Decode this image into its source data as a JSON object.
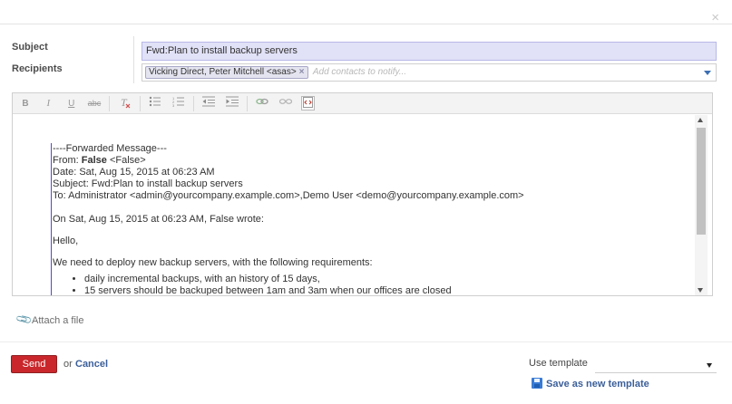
{
  "dialog": {
    "close_label": "×"
  },
  "form": {
    "subject_label": "Subject",
    "recipients_label": "Recipients",
    "subject_value": "Fwd:Plan to install backup servers",
    "recipient_tags": [
      "Vicking Direct, Peter Mitchell <asas>"
    ],
    "recipient_tag_remove": "×",
    "recipients_placeholder": "Add contacts to notify..."
  },
  "toolbar": {
    "buttons": [
      "B",
      "I",
      "U",
      "abc",
      "T",
      "list-bullets",
      "list-numbered",
      "outdent",
      "indent",
      "link",
      "unlink",
      "code"
    ],
    "active_button": "code-view"
  },
  "message": {
    "header": "----Forwarded Message---",
    "from_label": "From: ",
    "from_name": "False",
    "from_addr": " <False>",
    "date_line": "Date: Sat, Aug 15, 2015 at 06:23 AM",
    "subject_line": "Subject: Fwd:Plan to install backup servers",
    "to_line": "To: Administrator <admin@yourcompany.example.com>,Demo User <demo@yourcompany.example.com>",
    "wrote_line": "On Sat, Aug 15, 2015 at 06:23 AM, False wrote:",
    "greeting": "Hello,",
    "intro": "We need to deploy new backup servers, with the following requirements:",
    "requirements": [
      "daily incremental backups, with an history of 15 days,",
      "15 servers should be backuped between 1am and 3am when our offices are closed"
    ]
  },
  "attachments": {
    "attach_label": "Attach a file"
  },
  "footer": {
    "send_label": "Send",
    "or_label": "or",
    "cancel_label": "Cancel",
    "use_template_label": "Use template",
    "template_value": "",
    "save_template_label": "Save as new template"
  },
  "colors": {
    "send_button": "#c9272b",
    "link": "#3b5f9a",
    "subject_bg": "#e1e1f7",
    "quote_bar": "#4b4bd0"
  }
}
